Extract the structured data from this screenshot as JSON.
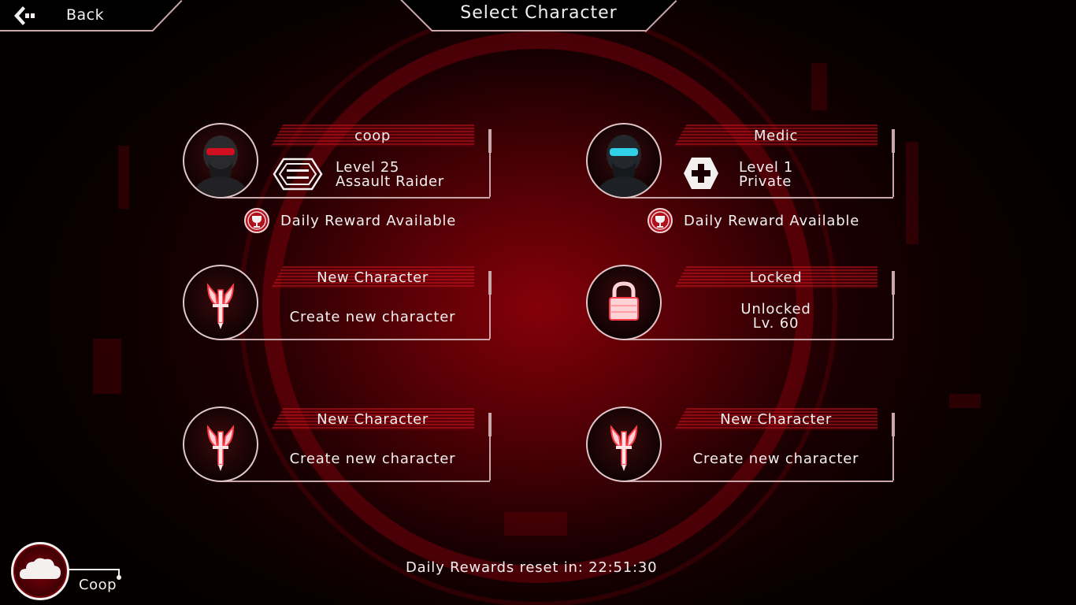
{
  "header": {
    "back_label": "Back",
    "title": "Select Character"
  },
  "slots": [
    {
      "name": "coop",
      "line1": "Level 25",
      "line2": "Assault Raider",
      "reward": "Daily Reward Available"
    },
    {
      "name": "Medic",
      "line1": "Level 1",
      "line2": "Private",
      "reward": "Daily Reward Available"
    },
    {
      "name": "New Character",
      "action": "Create new character"
    },
    {
      "name": "Locked",
      "line1": "Unlocked",
      "line2": "Lv. 60"
    },
    {
      "name": "New Character",
      "action": "Create new character"
    },
    {
      "name": "New Character",
      "action": "Create new character"
    }
  ],
  "footer": {
    "reset_text": "Daily Rewards reset in: 22:51:30",
    "profile_name": "Coop"
  },
  "colors": {
    "accent": "#c9a7ab",
    "glow": "#ff2a3a",
    "background": "#050000"
  },
  "icons": {
    "back": "back-arrow-icon",
    "rank_assault": "hexagon-rank-icon",
    "rank_medic": "medic-cross-icon",
    "reward": "trophy-icon",
    "new_character": "winged-dagger-icon",
    "locked": "padlock-icon",
    "profile": "cloud-icon"
  }
}
